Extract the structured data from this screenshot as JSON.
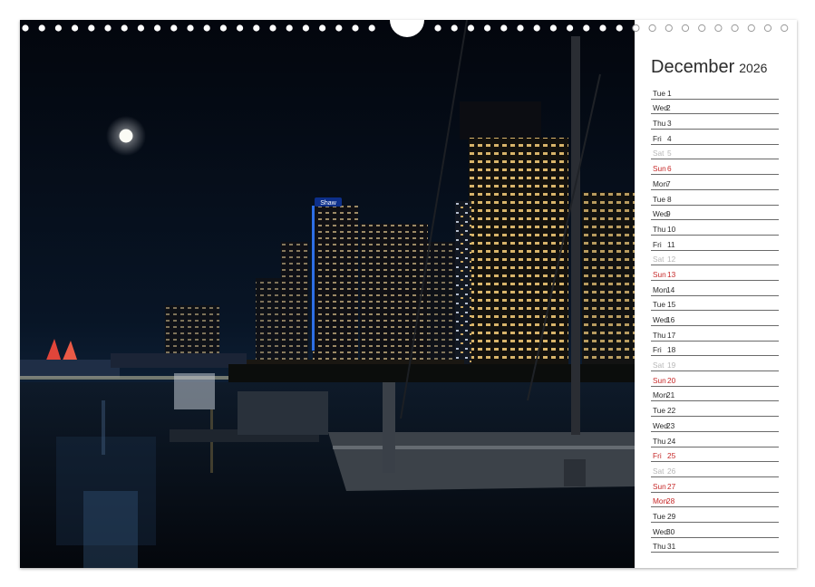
{
  "calendar": {
    "month": "December",
    "year": "2026",
    "days": [
      {
        "dow": "Tue",
        "num": "1",
        "type": "weekday"
      },
      {
        "dow": "Wed",
        "num": "2",
        "type": "weekday"
      },
      {
        "dow": "Thu",
        "num": "3",
        "type": "weekday"
      },
      {
        "dow": "Fri",
        "num": "4",
        "type": "weekday"
      },
      {
        "dow": "Sat",
        "num": "5",
        "type": "saturday"
      },
      {
        "dow": "Sun",
        "num": "6",
        "type": "sunday"
      },
      {
        "dow": "Mon",
        "num": "7",
        "type": "weekday"
      },
      {
        "dow": "Tue",
        "num": "8",
        "type": "weekday"
      },
      {
        "dow": "Wed",
        "num": "9",
        "type": "weekday"
      },
      {
        "dow": "Thu",
        "num": "10",
        "type": "weekday"
      },
      {
        "dow": "Fri",
        "num": "11",
        "type": "weekday"
      },
      {
        "dow": "Sat",
        "num": "12",
        "type": "saturday"
      },
      {
        "dow": "Sun",
        "num": "13",
        "type": "sunday"
      },
      {
        "dow": "Mon",
        "num": "14",
        "type": "weekday"
      },
      {
        "dow": "Tue",
        "num": "15",
        "type": "weekday"
      },
      {
        "dow": "Wed",
        "num": "16",
        "type": "weekday"
      },
      {
        "dow": "Thu",
        "num": "17",
        "type": "weekday"
      },
      {
        "dow": "Fri",
        "num": "18",
        "type": "weekday"
      },
      {
        "dow": "Sat",
        "num": "19",
        "type": "saturday"
      },
      {
        "dow": "Sun",
        "num": "20",
        "type": "sunday"
      },
      {
        "dow": "Mon",
        "num": "21",
        "type": "weekday"
      },
      {
        "dow": "Tue",
        "num": "22",
        "type": "weekday"
      },
      {
        "dow": "Wed",
        "num": "23",
        "type": "weekday"
      },
      {
        "dow": "Thu",
        "num": "24",
        "type": "weekday"
      },
      {
        "dow": "Fri",
        "num": "25",
        "type": "holiday"
      },
      {
        "dow": "Sat",
        "num": "26",
        "type": "saturday"
      },
      {
        "dow": "Sun",
        "num": "27",
        "type": "sunday"
      },
      {
        "dow": "Mon",
        "num": "28",
        "type": "holiday"
      },
      {
        "dow": "Tue",
        "num": "29",
        "type": "weekday"
      },
      {
        "dow": "Wed",
        "num": "30",
        "type": "weekday"
      },
      {
        "dow": "Thu",
        "num": "31",
        "type": "weekday"
      }
    ]
  },
  "colors": {
    "sunday_holiday": "#c62828",
    "saturday": "#b7b7b7",
    "weekday": "#2b2b2b",
    "night_sky": "#04070e"
  },
  "photo": {
    "sign_text": "Shaw"
  }
}
